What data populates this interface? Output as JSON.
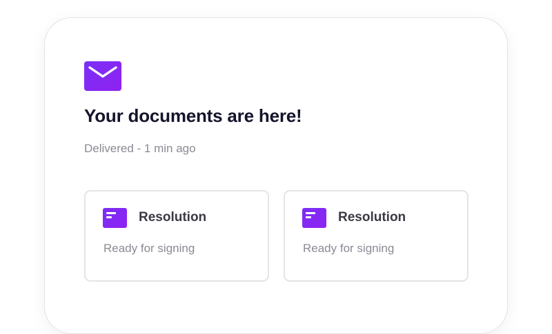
{
  "notification": {
    "icon": "mail-icon",
    "title": "Your documents are here!",
    "subtitle": "Delivered - 1 min ago"
  },
  "documents": [
    {
      "icon": "document-icon",
      "title": "Resolution",
      "status": "Ready for signing"
    },
    {
      "icon": "document-icon",
      "title": "Resolution",
      "status": "Ready for signing"
    }
  ],
  "colors": {
    "accent": "#7b2ff7",
    "accent_gradient_end": "#8f22f0",
    "title_text": "#14142b",
    "muted_text": "#8a8a94",
    "card_border": "#e4e4e7"
  }
}
